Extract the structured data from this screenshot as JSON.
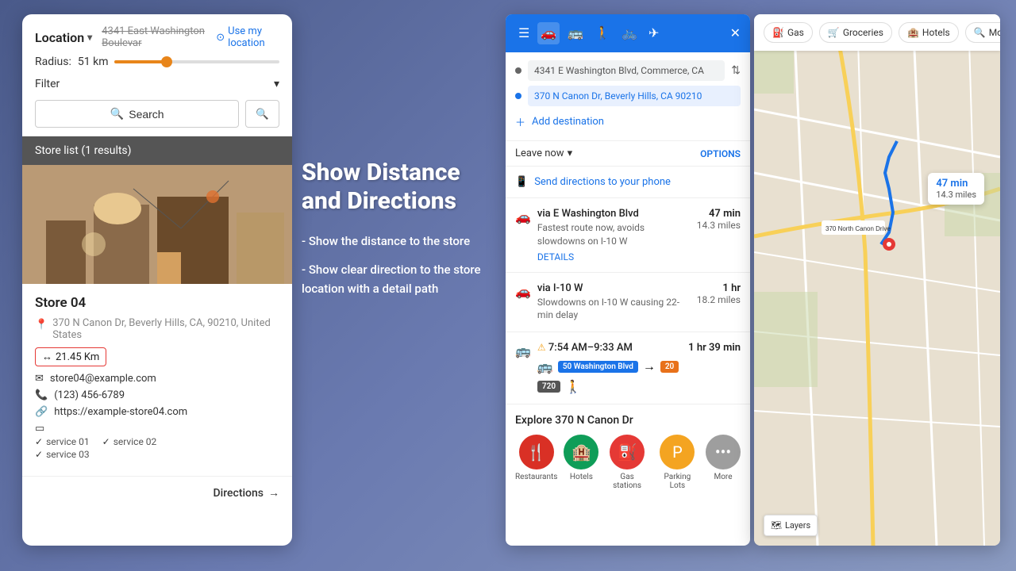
{
  "left_panel": {
    "location_label": "Location",
    "address_placeholder": "4341 East Washington Boulevar",
    "use_location": "Use my location",
    "radius_label": "Radius:",
    "radius_value": "51 km",
    "filter_label": "Filter",
    "search_label": "Search",
    "store_list_header": "Store list (1 results)",
    "store": {
      "name": "Store 04",
      "address": "370 N Canon Dr, Beverly Hills, CA, 90210, United States",
      "distance": "21.45 Km",
      "email": "store04@example.com",
      "phone": "(123) 456-6789",
      "url": "https://example-store04.com",
      "services": [
        "service 01",
        "service 02",
        "service 03"
      ]
    },
    "directions_label": "Directions"
  },
  "center": {
    "title": "Show Distance and Directions",
    "subtitle1": "- Show the distance to the store",
    "subtitle2": "- Show clear direction to the store location with a detail path"
  },
  "maps_panel": {
    "transport_modes": [
      "directions",
      "car",
      "bus",
      "walk",
      "bike",
      "flight"
    ],
    "origin": "4341 E Washington Blvd, Commerce, CA",
    "destination": "370 N Canon Dr, Beverly Hills, CA 90210",
    "add_destination": "Add destination",
    "leave_now": "Leave now",
    "options_label": "OPTIONS",
    "send_directions": "Send directions to your phone",
    "routes": [
      {
        "via": "via E Washington Blvd",
        "desc": "Fastest route now, avoids slowdowns on I-10 W",
        "time": "47 min",
        "distance": "14.3 miles",
        "details_label": "DETAILS"
      },
      {
        "via": "via I-10 W",
        "desc": "Slowdowns on I-10 W causing 22-min delay",
        "time": "1 hr",
        "distance": "18.2 miles"
      },
      {
        "via": "7:54 AM–9:33 AM",
        "desc": "50 Washington Blvd → 20 → 720",
        "time": "1 hr 39 min",
        "distance": "",
        "warning": true
      }
    ],
    "explore_title": "Explore 370 N Canon Dr",
    "explore_items": [
      {
        "label": "Restaurants",
        "color": "#d93025",
        "icon": "🍴"
      },
      {
        "label": "Hotels",
        "color": "#0f9d58",
        "icon": "🏨"
      },
      {
        "label": "Gas stations",
        "color": "#e53935",
        "icon": "⛽"
      },
      {
        "label": "Parking Lots",
        "color": "#f4a421",
        "icon": "P"
      },
      {
        "label": "More",
        "color": "#9e9e9e",
        "icon": "•••"
      }
    ]
  },
  "right_map": {
    "chips": [
      {
        "label": "Gas",
        "icon": "⛽"
      },
      {
        "label": "Groceries",
        "icon": "🛒"
      },
      {
        "label": "Hotels",
        "icon": "🏨"
      },
      {
        "label": "More",
        "icon": "🔍"
      }
    ],
    "info_box": {
      "time": "47 min",
      "distance": "14.3 miles"
    },
    "layers_label": "Layers",
    "destination_name": "370 North Canon Drive"
  }
}
